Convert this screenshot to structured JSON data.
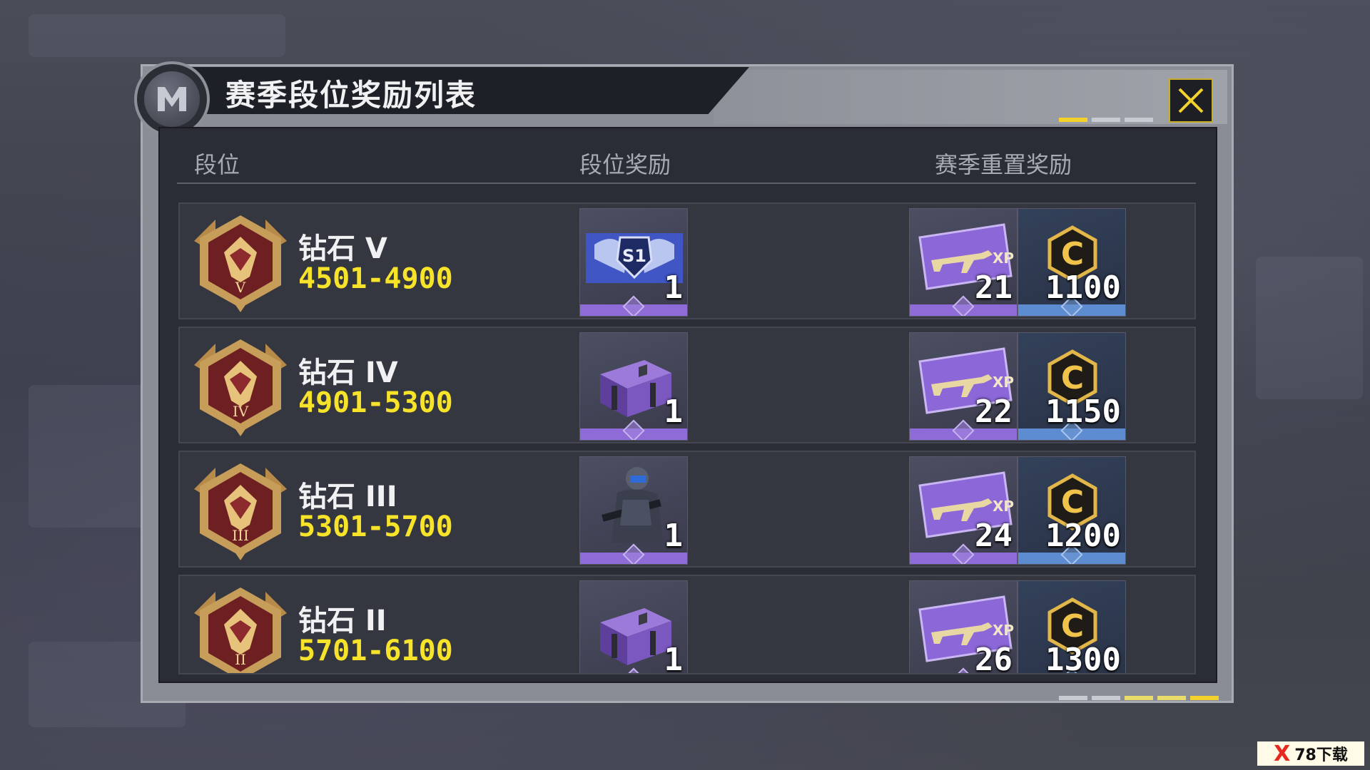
{
  "title": "赛季段位奖励列表",
  "columns": [
    "段位",
    "段位奖励",
    "赛季重置奖励"
  ],
  "rows": [
    {
      "rank": "钻石 V",
      "range": "4501-4900",
      "badge_numeral": "V",
      "rank_reward": {
        "icon": "season-emblem-icon",
        "count": "1"
      },
      "reset_xp": "21",
      "reset_cp": "1100"
    },
    {
      "rank": "钻石 IV",
      "range": "4901-5300",
      "badge_numeral": "IV",
      "rank_reward": {
        "icon": "supply-crate-icon",
        "count": "1"
      },
      "reset_xp": "22",
      "reset_cp": "1150"
    },
    {
      "rank": "钻石 III",
      "range": "5301-5700",
      "badge_numeral": "III",
      "rank_reward": {
        "icon": "operator-skin-icon",
        "count": "1"
      },
      "reset_xp": "24",
      "reset_cp": "1200"
    },
    {
      "rank": "钻石 II",
      "range": "5701-6100",
      "badge_numeral": "II",
      "rank_reward": {
        "icon": "supply-crate-icon",
        "count": "1"
      },
      "reset_xp": "26",
      "reset_cp": "1300"
    }
  ],
  "watermark": {
    "brand": "78下载"
  },
  "colors": {
    "accent": "#f3d22b",
    "range_text": "#f6e32a",
    "epic": "#8e6bd6",
    "rare": "#5d8cd0"
  }
}
